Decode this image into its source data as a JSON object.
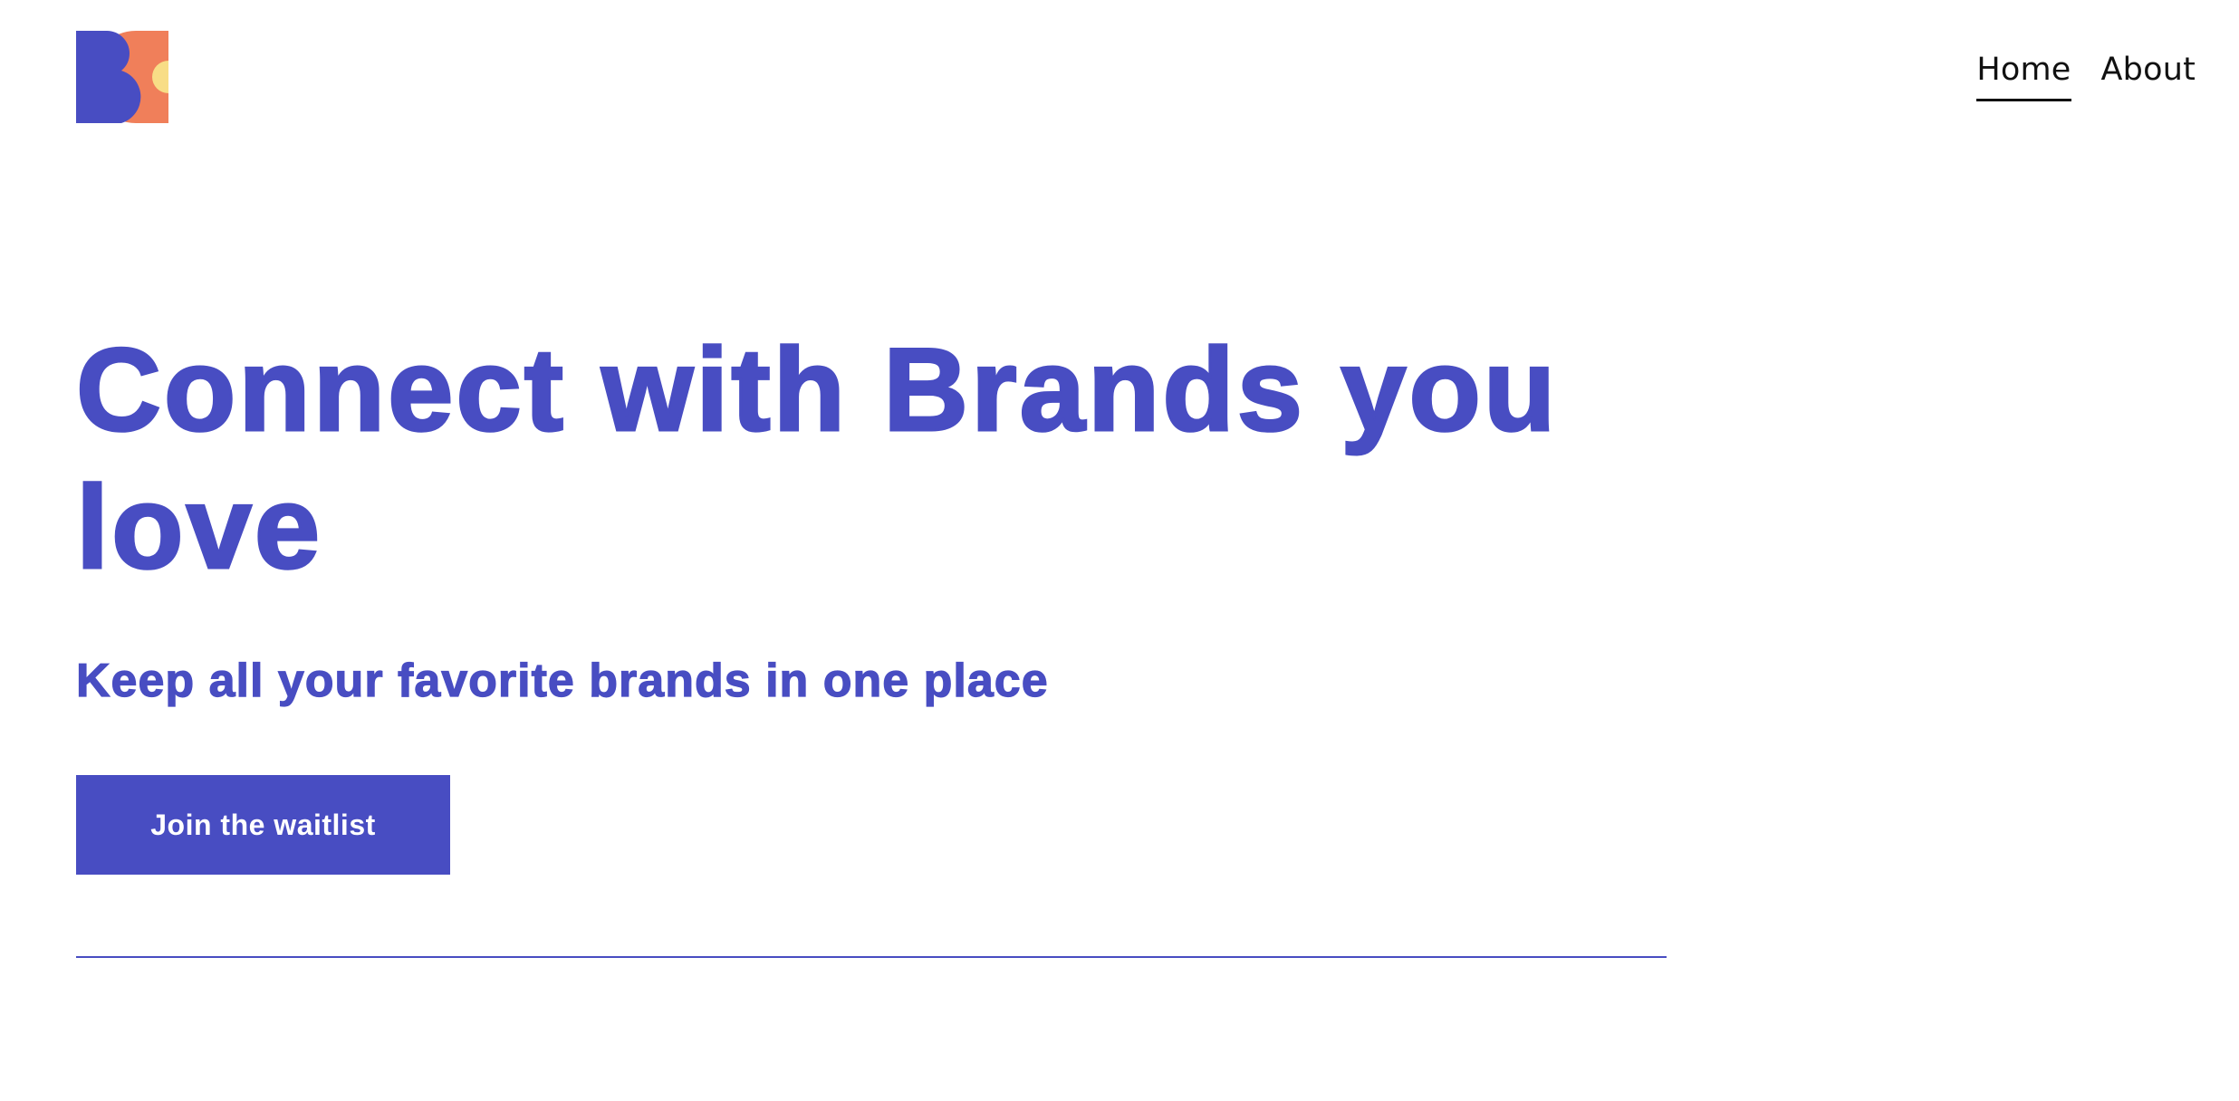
{
  "brand": {
    "logo_icon": "bc-brand-logo",
    "colors": {
      "primary": "#484dc2",
      "logo_orange": "#f07f5a",
      "logo_yellow": "#f8dd86"
    }
  },
  "nav": {
    "items": [
      {
        "label": "Home",
        "active": true
      },
      {
        "label": "About",
        "active": false
      }
    ]
  },
  "hero": {
    "title": "Connect with Brands you love",
    "subtitle": "Keep all your favorite brands in one place",
    "cta_label": "Join the waitlist"
  }
}
